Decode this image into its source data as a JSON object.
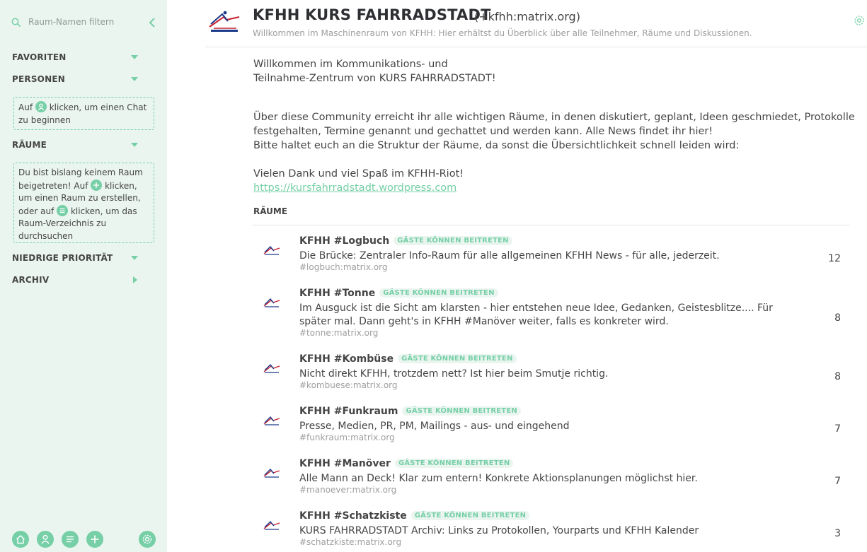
{
  "sidebar": {
    "filter_placeholder": "Raum-Namen filtern",
    "sections": {
      "favoriten": "FAVORITEN",
      "personen": "PERSONEN",
      "raeume": "RÄUME",
      "niedrige": "NIEDRIGE PRIORITÄT",
      "archiv": "ARCHIV"
    },
    "people_hint": {
      "pre": "Auf",
      "post": "klicken, um einen Chat zu beginnen"
    },
    "rooms_hint": {
      "part1": "Du bist bislang keinem Raum beigetreten! Auf",
      "part2": "klicken, um einen Raum zu erstellen, oder auf",
      "part3": "klicken, um das Raum-Verzeichnis zu durchsuchen"
    }
  },
  "header": {
    "title": "KFHH KURS FAHRRADSTADT",
    "alias": "(+kfhh:matrix.org)",
    "topic": "Willkommen im Maschinenraum von KFHH: Hier erhältst du Überblick über alle Teilnehmer, Räume und Diskussionen."
  },
  "description": {
    "line1": "Willkommen im Kommunikations- und",
    "line2": "Teilnahme-Zentrum von KURS FAHRRADSTADT!",
    "line3": "Über diese Community erreicht ihr alle wichtigen Räume, in denen diskutiert, geplant, Ideen geschmiedet, Protokolle",
    "line4": "festgehalten, Termine genannt und gechattet und werden kann. Alle News findet ihr hier!",
    "line5": "Bitte haltet euch an die Struktur der Räume, da sonst die Übersichtlichkeit schnell leiden wird:",
    "line6": "Vielen Dank und viel Spaß im KFHH-Riot!",
    "link": "https://kursfahrradstadt.wordpress.com"
  },
  "rooms_heading": "RÄUME",
  "rooms": [
    {
      "name": "KFHH #Logbuch",
      "badge": "GÄSTE KÖNNEN BEITRETEN",
      "desc": "Die Brücke: Zentraler Info-Raum für alle allgemeinen KFHH News - für alle, jederzeit.",
      "alias": "#logbuch:matrix.org",
      "count": "12"
    },
    {
      "name": "KFHH #Tonne",
      "badge": "GÄSTE KÖNNEN BEITRETEN",
      "desc": "Im Ausguck ist die Sicht am klarsten - hier entstehen neue Idee, Gedanken, Geistesblitze.... Für später mal. Dann geht's in KFHH #Manöver weiter, falls es konkreter wird.",
      "alias": "#tonne:matrix.org",
      "count": "8"
    },
    {
      "name": "KFHH #Kombüse",
      "badge": "GÄSTE KÖNNEN BEITRETEN",
      "desc": "Nicht direkt KFHH, trotzdem nett? Ist hier beim Smutje richtig.",
      "alias": "#kombuese:matrix.org",
      "count": "8"
    },
    {
      "name": "KFHH #Funkraum",
      "badge": "GÄSTE KÖNNEN BEITRETEN",
      "desc": "Presse, Medien, PR, PM, Mailings - aus- und eingehend",
      "alias": "#funkraum:matrix.org",
      "count": "7"
    },
    {
      "name": "KFHH #Manöver",
      "badge": "GÄSTE KÖNNEN BEITRETEN",
      "desc": "Alle Mann an Deck! Klar zum entern! Konkrete Aktionsplanungen möglichst hier.",
      "alias": "#manoever:matrix.org",
      "count": "7"
    },
    {
      "name": "KFHH #Schatzkiste",
      "badge": "GÄSTE KÖNNEN BEITRETEN",
      "desc": "KURS FAHRRADSTADT Archiv: Links zu Protokollen, Yourparts und KFHH Kalender",
      "alias": "#schatzkiste:matrix.org",
      "count": "3"
    }
  ],
  "colors": {
    "accent": "#76cfa6",
    "sidebar_bg": "#eaf5f0",
    "text": "#454545",
    "muted": "#9e9e9e"
  },
  "icons": [
    "search-icon",
    "collapse-left-icon",
    "person-icon",
    "plus-icon",
    "list-icon",
    "home-icon",
    "gear-icon",
    "kfhh-logo"
  ]
}
